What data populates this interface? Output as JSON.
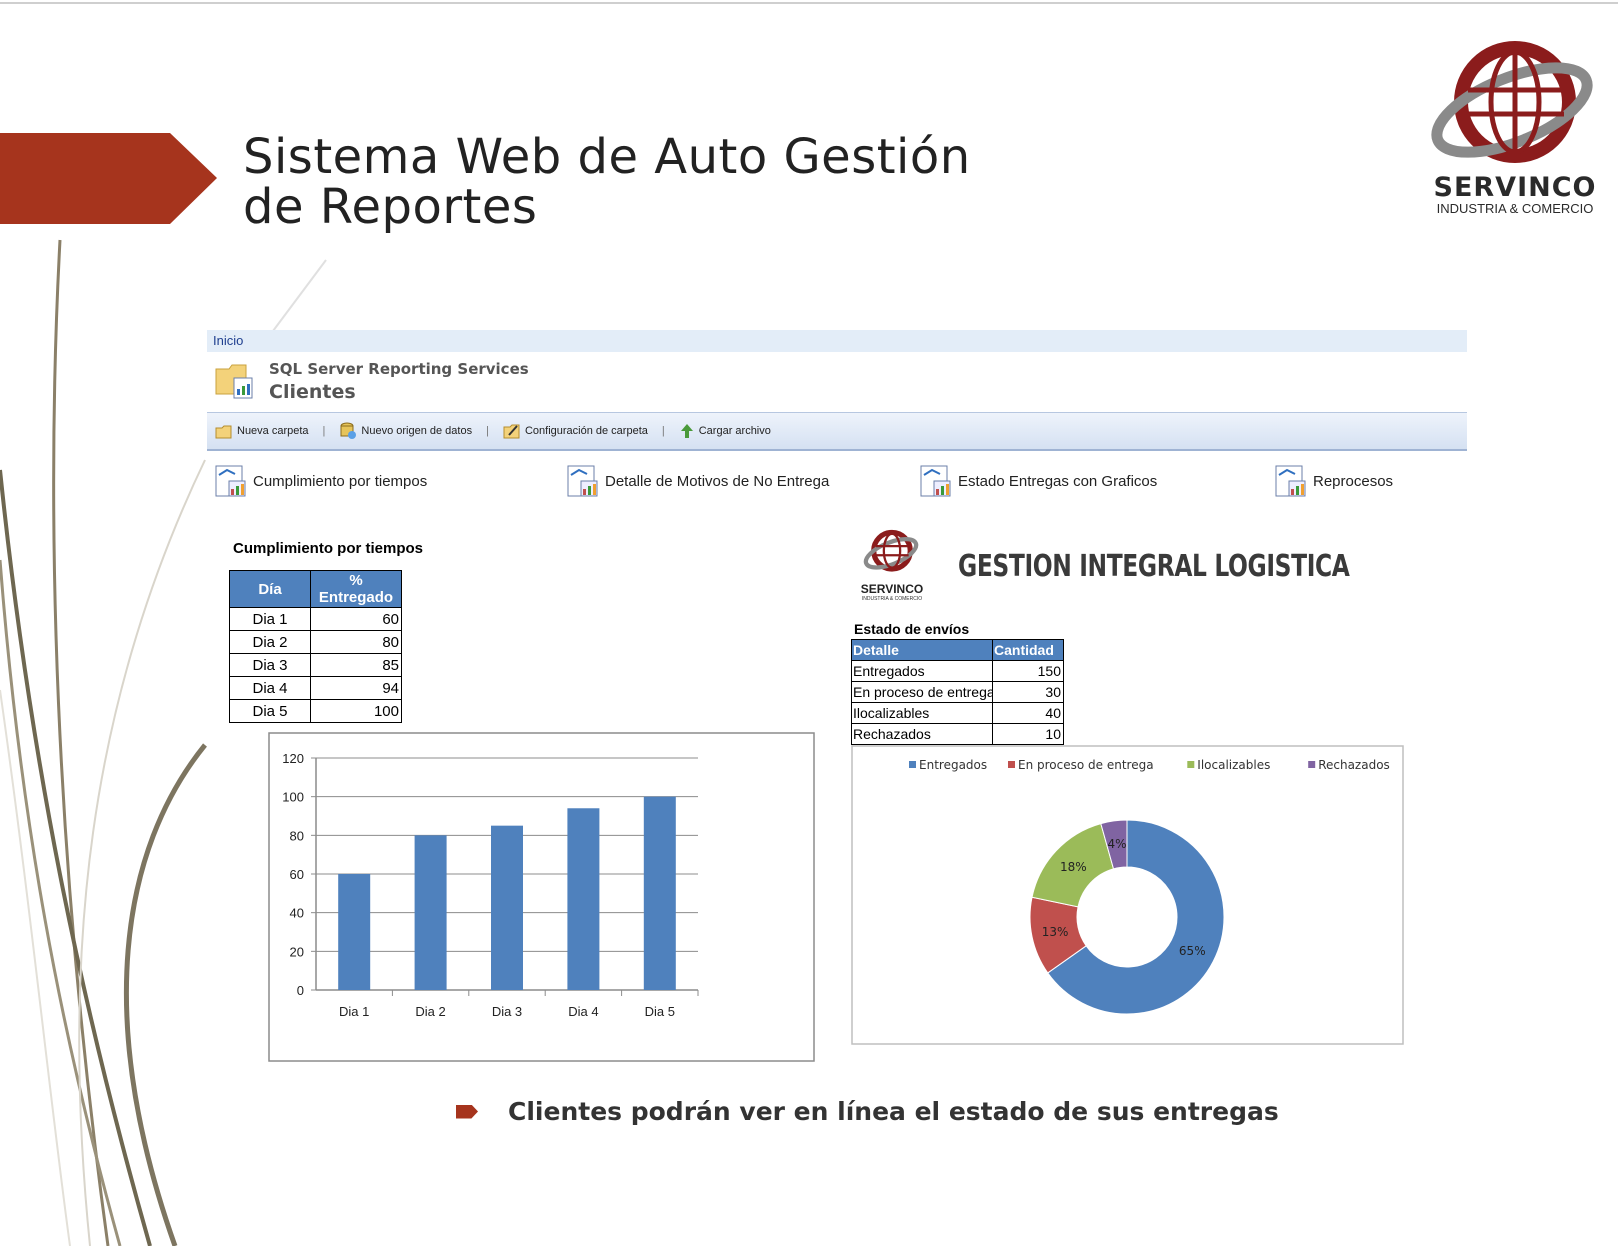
{
  "slide": {
    "title_line1": "Sistema Web de Auto Gestión",
    "title_line2": "de Reportes",
    "footer_bullet": "Clientes podrán ver en línea el estado de sus entregas",
    "accent_color": "#a6341d"
  },
  "logo": {
    "brand": "SERVINCO",
    "tagline": "INDUSTRIA & COMERCIO"
  },
  "ssrs": {
    "breadcrumb": "Inicio",
    "app_name": "SQL Server Reporting Services",
    "folder_title": "Clientes",
    "toolbar": {
      "new_folder": "Nueva carpeta",
      "new_datasource": "Nuevo origen de datos",
      "folder_settings": "Configuración de carpeta",
      "upload": "Cargar archivo"
    },
    "reports": [
      {
        "label": "Cumplimiento por tiempos"
      },
      {
        "label": "Detalle de Motivos de No Entrega"
      },
      {
        "label": "Estado Entregas con Graficos"
      },
      {
        "label": "Reprocesos"
      }
    ]
  },
  "report1": {
    "heading": "Cumplimiento por tiempos",
    "col_day": "Día",
    "col_pct": "% Entregado",
    "rows": [
      {
        "day": "Dia 1",
        "pct": "60"
      },
      {
        "day": "Dia 2",
        "pct": "80"
      },
      {
        "day": "Dia 3",
        "pct": "85"
      },
      {
        "day": "Dia 4",
        "pct": "94"
      },
      {
        "day": "Dia 5",
        "pct": "100"
      }
    ]
  },
  "report2": {
    "logo_brand": "SERVINCO",
    "logo_tagline": "INDUSTRIA & COMERCIO",
    "title": "GESTION INTEGRAL LOGISTICA",
    "heading": "Estado de envíos",
    "col_detail": "Detalle",
    "col_qty": "Cantidad",
    "rows": [
      {
        "detail": "Entregados",
        "qty": "150"
      },
      {
        "detail": "En proceso de entrega",
        "qty": "30"
      },
      {
        "detail": "Ilocalizables",
        "qty": "40"
      },
      {
        "detail": "Rechazados",
        "qty": "10"
      }
    ]
  },
  "chart_data": [
    {
      "type": "bar",
      "categories": [
        "Dia 1",
        "Dia 2",
        "Dia 3",
        "Dia 4",
        "Dia 5"
      ],
      "values": [
        60,
        80,
        85,
        94,
        100
      ],
      "ylim": [
        0,
        120
      ],
      "yticks": [
        0,
        20,
        40,
        60,
        80,
        100,
        120
      ],
      "grid": true,
      "color": "#4f81bd"
    },
    {
      "type": "pie",
      "donut": true,
      "categories": [
        "Entregados",
        "En proceso de entrega",
        "Ilocalizables",
        "Rechazados"
      ],
      "values": [
        150,
        30,
        40,
        10
      ],
      "labels": [
        "65%",
        "13%",
        "18%",
        "4%"
      ],
      "colors": [
        "#4f81bd",
        "#c0504d",
        "#9bbb59",
        "#8064a2"
      ],
      "legend": "top"
    }
  ]
}
